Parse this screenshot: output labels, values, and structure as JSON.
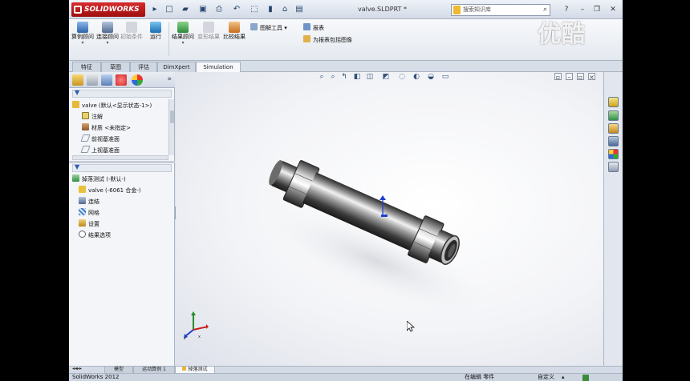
{
  "app": {
    "logo_text": "SOLIDWORKS",
    "document_title": "valve.SLDPRT *",
    "search_placeholder": "搜索知识库"
  },
  "ribbon": {
    "new_study": "算例顾问",
    "fixtures": "连接顾问",
    "external_loads": "初始条件",
    "run": "运行",
    "results_advisor": "结果顾问",
    "deformed_result": "变形结果",
    "compare_results": "比较结果",
    "plot_tools": "图解工具",
    "report": "报表",
    "include_image": "为报表包括图像"
  },
  "command_tabs": [
    "特征",
    "草图",
    "评估",
    "DimXpert",
    "Simulation"
  ],
  "feature_tree": {
    "root": "valve  (默认<显示状态-1>)",
    "items": [
      "注解",
      "材质 <未指定>",
      "前视基准面",
      "上视基准面"
    ]
  },
  "study_tree": {
    "root": "掉落测试 (-默认-)",
    "items": [
      "valve (-6061 合金-)",
      "连结",
      "网格",
      "设置",
      "结果选项"
    ]
  },
  "bottom_tabs": [
    "模型",
    "运动算例 1",
    "掉落测试"
  ],
  "status": {
    "left": "SolidWorks 2012",
    "editing": "在编辑 零件",
    "custom": "自定义"
  },
  "watermark": "优酷",
  "colors": {
    "accent_red": "#c41e1e",
    "ribbon_bg": "#eef1f5",
    "viewport_bg": "#f3f4f7"
  }
}
